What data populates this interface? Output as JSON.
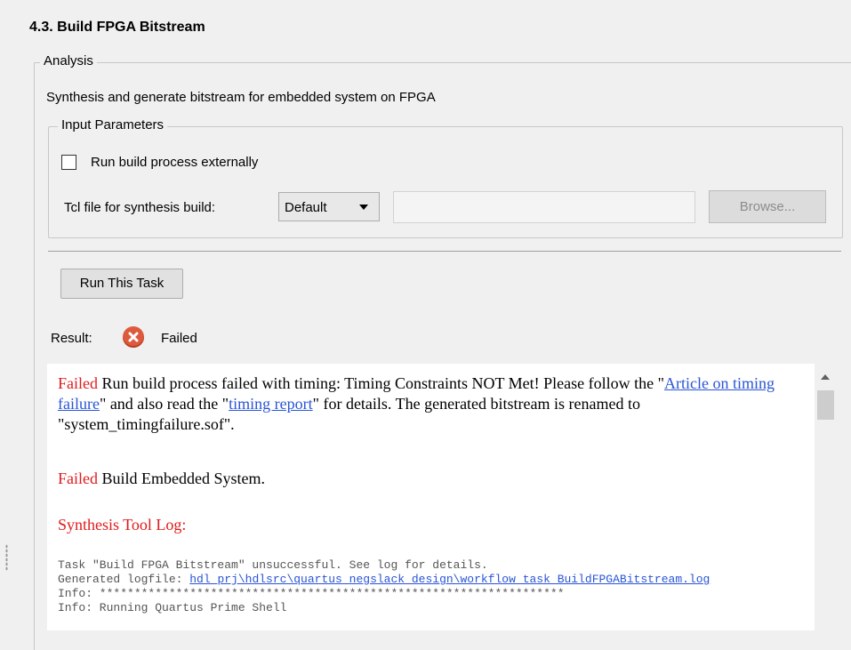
{
  "task": {
    "title": "4.3. Build FPGA Bitstream"
  },
  "analysis": {
    "legend": "Analysis",
    "description": "Synthesis and generate bitstream for embedded system on FPGA"
  },
  "input_parameters": {
    "legend": "Input Parameters",
    "run_externally_label": "Run build process externally",
    "run_externally_checked": false,
    "tcl_label": "Tcl file for synthesis build:",
    "tcl_selected": "Default",
    "tcl_path_value": "",
    "browse_label": "Browse..."
  },
  "run_button": {
    "label": "Run This Task"
  },
  "result": {
    "label": "Result:",
    "status": "Failed",
    "status_icon": "error-x-icon",
    "status_color": "#dd5a3c"
  },
  "log": {
    "p1": {
      "failed": "Failed",
      "text1": " Run build process failed with timing: Timing Constraints NOT Met! Please follow the \"",
      "link1": "Article on timing failure",
      "text2": "\" and also read the \"",
      "link2": "timing report",
      "text3": "\" for details. The generated bitstream is renamed to \"system_timingfailure.sof\"."
    },
    "p2": {
      "failed": "Failed",
      "text": " Build Embedded System."
    },
    "synthesis_heading": "Synthesis Tool Log:",
    "line1": "Task \"Build FPGA Bitstream\" unsuccessful. See log for details.",
    "line2_prefix": "Generated logfile: ",
    "line2_link": "hdl_prj\\hdlsrc\\quartus_negslack_design\\workflow_task_BuildFPGABitstream.log",
    "line3": "Info: *******************************************************************",
    "line4": "Info: Running Quartus Prime Shell"
  },
  "colors": {
    "error_text": "#e01b1b",
    "link": "#2a55d6"
  }
}
